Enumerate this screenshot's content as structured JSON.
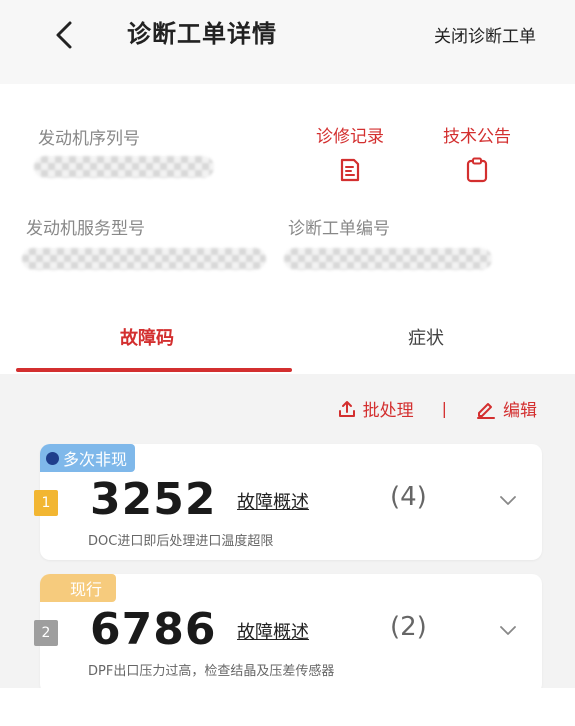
{
  "header": {
    "title": "诊断工单详情",
    "close_label": "关闭诊断工单"
  },
  "info": {
    "engine_serial_label": "发动机序列号",
    "engine_service_model_label": "发动机服务型号",
    "work_order_no_label": "诊断工单编号",
    "repair_record_label": "诊修记录",
    "tech_bulletin_label": "技术公告"
  },
  "tabs": [
    {
      "label": "故障码"
    },
    {
      "label": "症状"
    }
  ],
  "toolbar": {
    "batch_label": "批处理",
    "separator": "|",
    "edit_label": "编辑"
  },
  "faults": [
    {
      "badge": "多次非现",
      "rank": "1",
      "code": "3252",
      "summary": "故障概述",
      "count": "(4)",
      "description": "DOC进口即后处理进口温度超限"
    },
    {
      "badge": "现行",
      "rank": "2",
      "code": "6786",
      "summary": "故障概述",
      "count": "(2)",
      "description": "DPF出口压力过高，检查结晶及压差传感器"
    }
  ],
  "colors": {
    "accent": "#d32f2f",
    "badge_blue": "#7fb8ea",
    "badge_orange": "#f6cb7d"
  }
}
